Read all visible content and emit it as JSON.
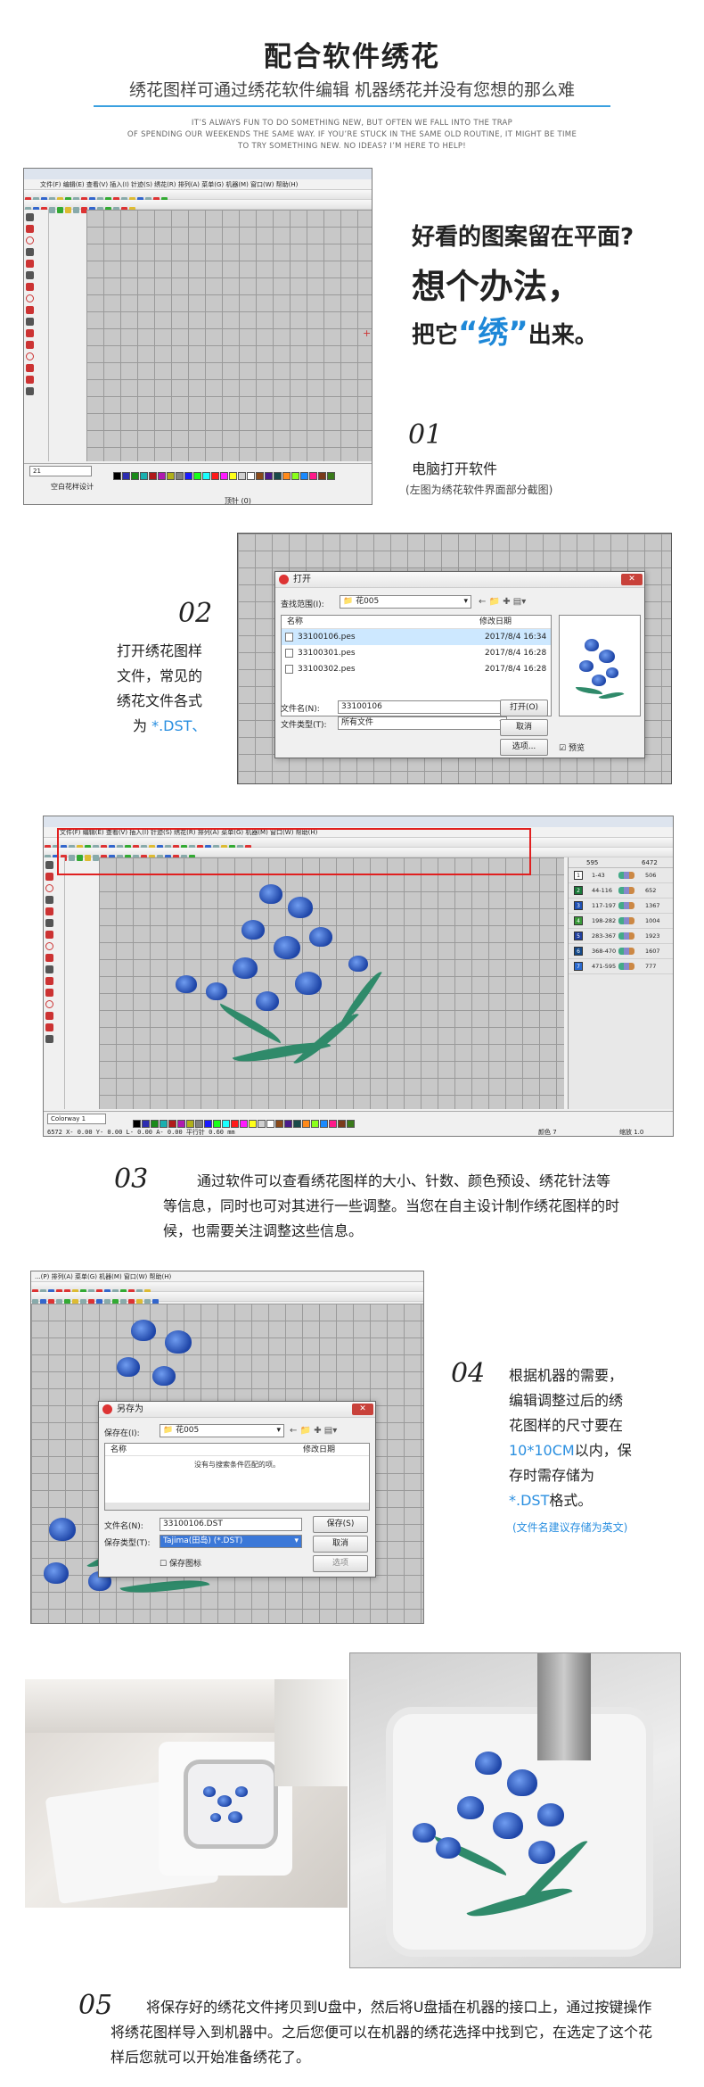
{
  "header": {
    "title": "配合软件绣花",
    "subtitle": "绣花图样可通过绣花软件编辑  机器绣花并没有您想的那么难",
    "english_lines": [
      "IT’S ALWAYS FUN TO DO SOMETHING NEW, BUT OFTEN WE FALL INTO THE TRAP",
      "OF SPENDING OUR WEEKENDS THE SAME WAY. IF YOU’RE STUCK IN THE SAME OLD ROUTINE, IT MIGHT BE TIME",
      "TO TRY SOMETHING NEW. NO IDEAS? I’M HERE TO HELP!"
    ]
  },
  "app": {
    "menu": "文件(F)   编辑(E)   查看(V)   插入(I)   针迹(S)   绣花(R)   排列(A)   菜单(G)   机器(M)   窗口(W)   帮助(H)",
    "status_left": "空白花样设计",
    "status_mid": "顶针 (0)",
    "font_select": "21",
    "colorway": "Colorway 1",
    "status_bar_3": "6572 X-   0.00 Y-   0.00 L-   0.00 A-   0.00 平行针  0.60 mm",
    "status_right_3a": "颜色 7",
    "status_right_3b": "缩放 1.0",
    "color_table": [
      {
        "idx": "1",
        "range": "1-43",
        "count": "506"
      },
      {
        "idx": "2",
        "range": "44-116",
        "count": "652"
      },
      {
        "idx": "3",
        "range": "117-197",
        "count": "1367"
      },
      {
        "idx": "4",
        "range": "198-282",
        "count": "1004"
      },
      {
        "idx": "5",
        "range": "283-367",
        "count": "1923"
      },
      {
        "idx": "6",
        "range": "368-470",
        "count": "1607"
      },
      {
        "idx": "7",
        "range": "471-595",
        "count": "777"
      }
    ],
    "color_table_header": {
      "a": "595",
      "b": "6472"
    },
    "swatch_colors": [
      "#ffffff",
      "#1a7a3a",
      "#1d4fb3",
      "#3a9a3a",
      "#1f3f9f",
      "#154a8a",
      "#2a6ad0"
    ],
    "palette": [
      "#000000",
      "#2d2db0",
      "#1a8a1a",
      "#1ab0b0",
      "#b01a1a",
      "#b01ab0",
      "#b0b01a",
      "#808080",
      "#1a1aff",
      "#1aff1a",
      "#1affff",
      "#ff1a1a",
      "#ff1aff",
      "#ffff1a",
      "#d0d0d0",
      "#ffffff",
      "#8a4a1a",
      "#4a1a8a",
      "#1a4a4a",
      "#ff8a1a",
      "#8aff1a",
      "#1a8aff",
      "#ff1a8a",
      "#7a3a1a",
      "#3a7a1a"
    ]
  },
  "step1": {
    "q1": "好看的图案留在平面?",
    "q2": "想个办法，",
    "q3_pre": "把它",
    "q3_hl": "“绣”",
    "q3_post": "出来。",
    "number": "01",
    "text": "电脑打开软件",
    "caption": "(左图为绣花软件界面部分截图)"
  },
  "step2": {
    "number": "02",
    "lines": [
      "打开绣花图样",
      "文件，常见的",
      "绣花文件各式"
    ],
    "last_pre": "为 ",
    "last_hl": "*.DST、",
    "dialog": {
      "title": "打开",
      "lookin_label": "查找范围(I):",
      "lookin_value": "花005",
      "col_name": "名称",
      "col_date": "修改日期",
      "files": [
        {
          "name": "33100106.pes",
          "date": "2017/8/4 16:34"
        },
        {
          "name": "33100301.pes",
          "date": "2017/8/4 16:28"
        },
        {
          "name": "33100302.pes",
          "date": "2017/8/4 16:28"
        }
      ],
      "filename_label": "文件名(N):",
      "filename_value": "33100106",
      "filetype_label": "文件类型(T):",
      "filetype_value": "所有文件",
      "open_btn": "打开(O)",
      "cancel_btn": "取消",
      "options_btn": "选项...",
      "preview_label": "预览"
    }
  },
  "step3": {
    "number": "03",
    "text": "通过软件可以查看绣花图样的大小、针数、颜色预设、绣花针法等等信息，同时也可对其进行一些调整。当您在自主设计制作绣花图样的时候，也需要关注调整这些信息。"
  },
  "step4": {
    "number": "04",
    "lines": [
      "根据机器的需要，",
      "编辑调整过后的绣",
      "花图样的尺寸要在"
    ],
    "size_hl": "10*10CM",
    "size_post": "以内，保",
    "line5": "存时需存储为",
    "fmt_hl": "*.DST",
    "fmt_post": "格式。",
    "note": "(文件名建议存储为英文)",
    "menu": "...(P)   排列(A)   菜单(G)   机器(M)   窗口(W)   帮助(H)",
    "dialog": {
      "title": "另存为",
      "savein_label": "保存在(I):",
      "savein_value": "花005",
      "col_name": "名称",
      "col_date": "修改日期",
      "empty_msg": "没有与搜索条件匹配的项。",
      "filename_label": "文件名(N):",
      "filename_value": "33100106.DST",
      "filetype_label": "保存类型(T):",
      "filetype_value": "Tajima(田岛)  (*.DST)",
      "save_btn": "保存(S)",
      "cancel_btn": "取消",
      "options_btn": "选项",
      "save_icon_label": "保存图标"
    }
  },
  "step5": {
    "number": "05",
    "text": "将保存好的绣花文件拷贝到U盘中，然后将U盘插在机器的接口上，通过按键操作将绣花图样导入到机器中。之后您便可以在机器的绣花选择中找到它，在选定了这个花样后您就可以开始准备绣花了。"
  }
}
